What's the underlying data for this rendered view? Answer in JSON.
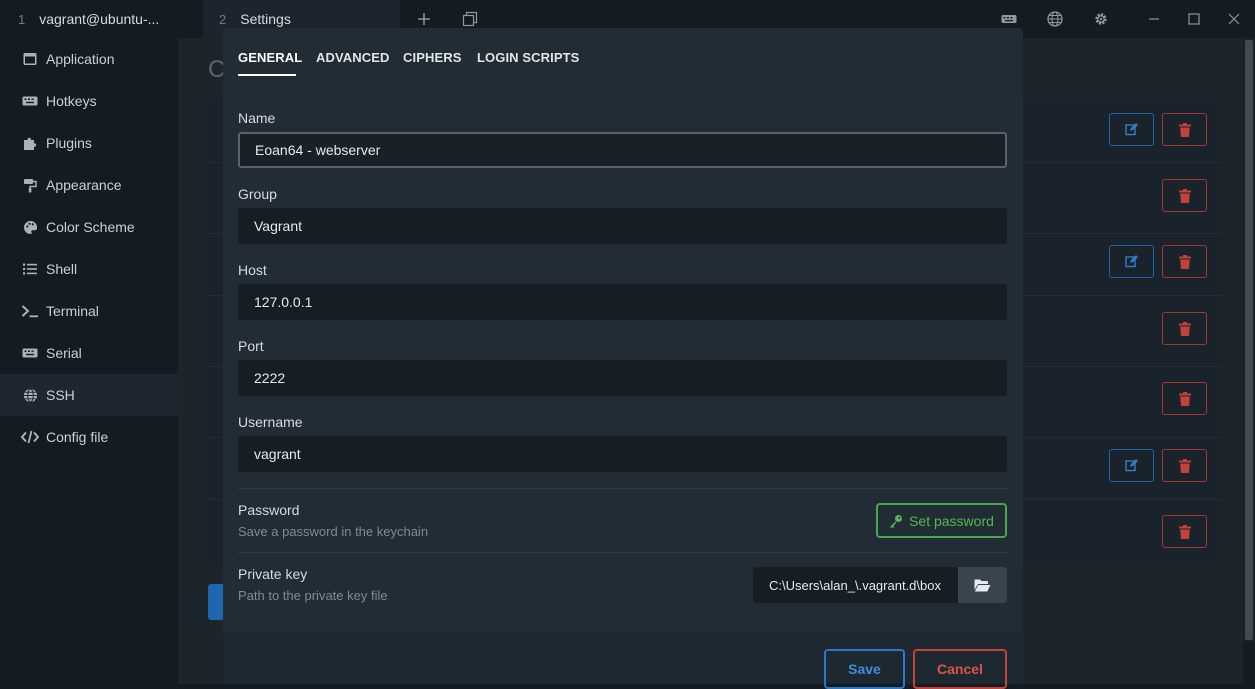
{
  "titlebar": {
    "tabs": [
      {
        "num": "1",
        "title": "vagrant@ubuntu-..."
      },
      {
        "num": "2",
        "title": "Settings"
      }
    ],
    "icons": [
      "plus-icon",
      "restore-tabs-icon",
      "keyboard-icon",
      "globe-icon",
      "gear-icon",
      "minimize-icon",
      "maximize-icon",
      "close-icon"
    ]
  },
  "sidebar": {
    "items": [
      {
        "label": "Application",
        "icon": "window-icon"
      },
      {
        "label": "Hotkeys",
        "icon": "keyboard-icon"
      },
      {
        "label": "Plugins",
        "icon": "puzzle-icon"
      },
      {
        "label": "Appearance",
        "icon": "paint-brush-icon"
      },
      {
        "label": "Color Scheme",
        "icon": "palette-icon"
      },
      {
        "label": "Shell",
        "icon": "list-icon"
      },
      {
        "label": "Terminal",
        "icon": "terminal-icon"
      },
      {
        "label": "Serial",
        "icon": "keyboard-icon"
      },
      {
        "label": "SSH",
        "icon": "globe-icon",
        "active": true
      },
      {
        "label": "Config file",
        "icon": "code-icon"
      }
    ]
  },
  "background": {
    "title_fragment": "C"
  },
  "modal": {
    "tabs": [
      "GENERAL",
      "ADVANCED",
      "CIPHERS",
      "LOGIN SCRIPTS"
    ],
    "active_tab": "GENERAL",
    "fields": {
      "name": {
        "label": "Name",
        "value": "Eoan64 - webserver"
      },
      "group": {
        "label": "Group",
        "value": "Vagrant"
      },
      "host": {
        "label": "Host",
        "value": "127.0.0.1"
      },
      "port": {
        "label": "Port",
        "value": "2222"
      },
      "username": {
        "label": "Username",
        "value": "vagrant"
      }
    },
    "password": {
      "label": "Password",
      "description": "Save a password in the keychain",
      "button": "Set password"
    },
    "private_key": {
      "label": "Private key",
      "description": "Path to the private key file",
      "value": "C:\\Users\\alan_\\.vagrant.d\\box"
    },
    "footer": {
      "save": "Save",
      "cancel": "Cancel"
    }
  },
  "colors": {
    "accent_blue": "#2a78c6",
    "danger_red": "#c4423a",
    "success_green": "#4aa84c"
  }
}
